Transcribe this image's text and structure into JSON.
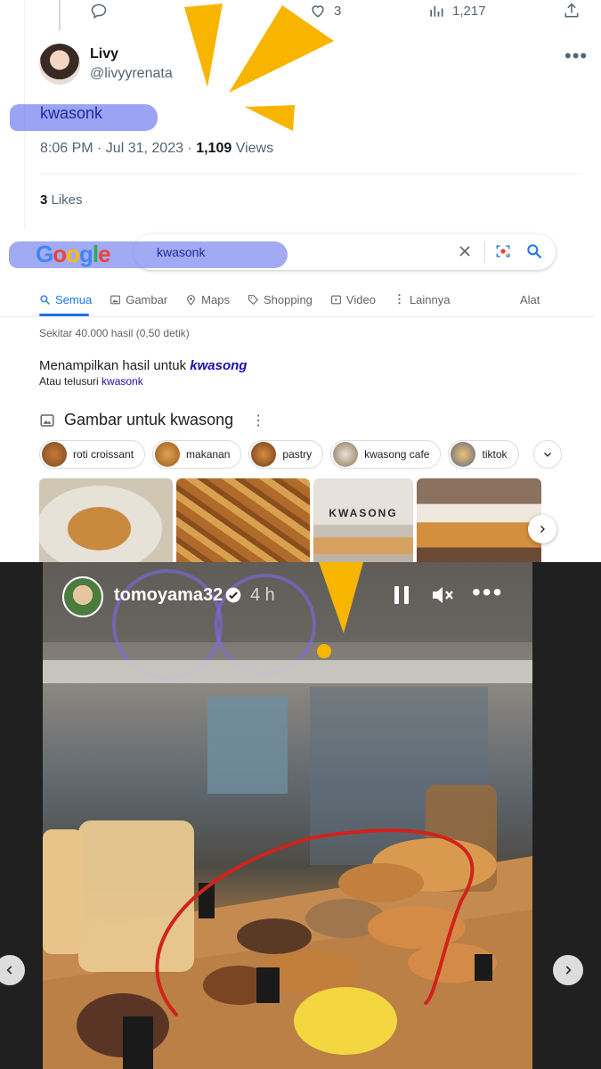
{
  "tweet": {
    "actions": {
      "views_count": "1,217",
      "retweets_count": "3"
    },
    "author_name": "Livy",
    "author_handle": "@livyyrenata",
    "text": "kwasonk",
    "timestamp": "8:06 PM · Jul 31, 2023 · ",
    "views_number": "1,109",
    "views_label": " Views",
    "likes_number": "3",
    "likes_label": " Likes"
  },
  "google": {
    "logo_letters": [
      "G",
      "o",
      "o",
      "g",
      "l",
      "e"
    ],
    "query": "kwasonk",
    "nav": [
      {
        "label": "Semua",
        "icon": "search-icon"
      },
      {
        "label": "Gambar",
        "icon": "image-icon"
      },
      {
        "label": "Maps",
        "icon": "map-pin-icon"
      },
      {
        "label": "Shopping",
        "icon": "tag-icon"
      },
      {
        "label": "Video",
        "icon": "play-icon"
      },
      {
        "label": "Lainnya",
        "icon": "more-vert-icon"
      }
    ],
    "tools_label": "Alat",
    "result_stats": "Sekitar 40.000 hasil (0,50 detik)",
    "showing_prefix": "Menampilkan hasil untuk ",
    "showing_term": "kwasong",
    "instead_prefix": "Atau telusuri ",
    "instead_term": "kwasonk",
    "images_heading": "Gambar untuk kwasong",
    "chips": [
      "roti croissant",
      "makanan",
      "pastry",
      "kwasong cafe",
      "tiktok"
    ],
    "kwasong_sign": "KWASONG"
  },
  "story": {
    "username": "tomoyama32",
    "time": "4 h"
  },
  "colors": {
    "highlight": "#7a86f0",
    "google_blue": "#1a73e8",
    "link_blue": "#1a0dab",
    "burst_yellow": "#f7b500",
    "annotation_red": "#d1221b"
  }
}
